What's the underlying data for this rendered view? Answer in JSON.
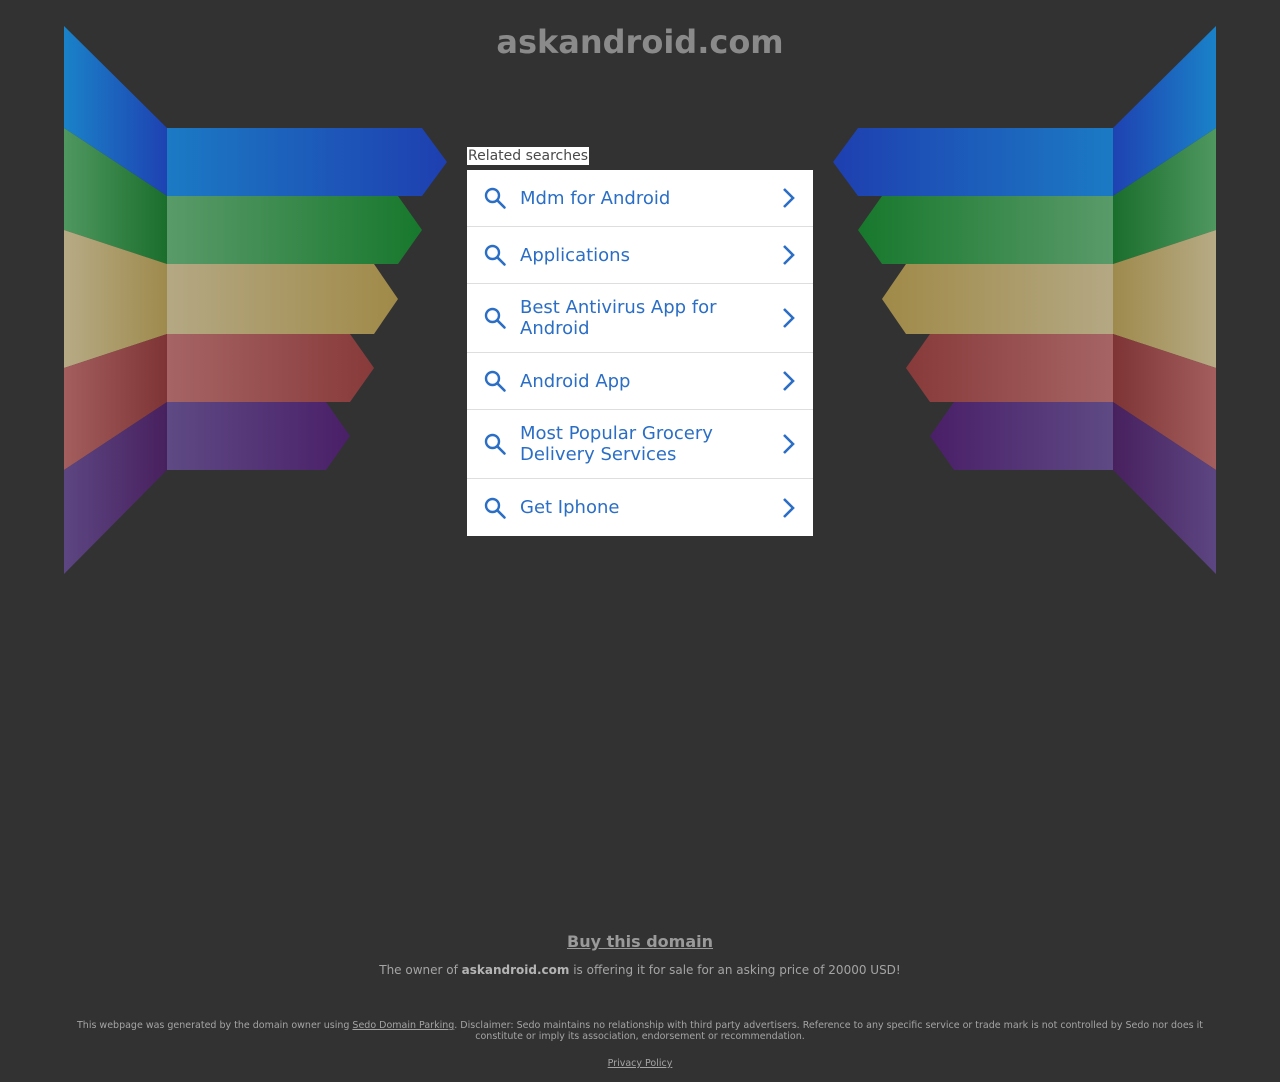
{
  "page": {
    "domain": "askandroid.com"
  },
  "related": {
    "label": "Related searches",
    "items": [
      {
        "text": "Mdm for Android"
      },
      {
        "text": "Applications"
      },
      {
        "text": "Best Antivirus App for Android"
      },
      {
        "text": "Android App"
      },
      {
        "text": "Most Popular Grocery Delivery Services"
      },
      {
        "text": "Get Iphone"
      }
    ]
  },
  "footer": {
    "buy_label": "Buy this domain",
    "sale_prefix": "The owner of ",
    "sale_domain": "askandroid.com",
    "sale_suffix": " is offering it for sale for an asking price of 20000 USD!",
    "disclaimer_prefix": "This webpage was generated by the domain owner using ",
    "disclaimer_link": "Sedo Domain Parking",
    "disclaimer_suffix": ". Disclaimer: Sedo maintains no relationship with third party advertisers. Reference to any specific service or trade mark is not controlled by Sedo nor does it constitute or imply its association, endorsement or recommendation.",
    "privacy_label": "Privacy Policy"
  },
  "colors": {
    "background": "#323232",
    "link": "#2b6ec5",
    "stripe_blue": "#1e48b4",
    "stripe_green": "#1d7a34",
    "stripe_tan": "#a8905a",
    "stripe_red": "#8e4545",
    "stripe_purple": "#4d2a6e"
  }
}
